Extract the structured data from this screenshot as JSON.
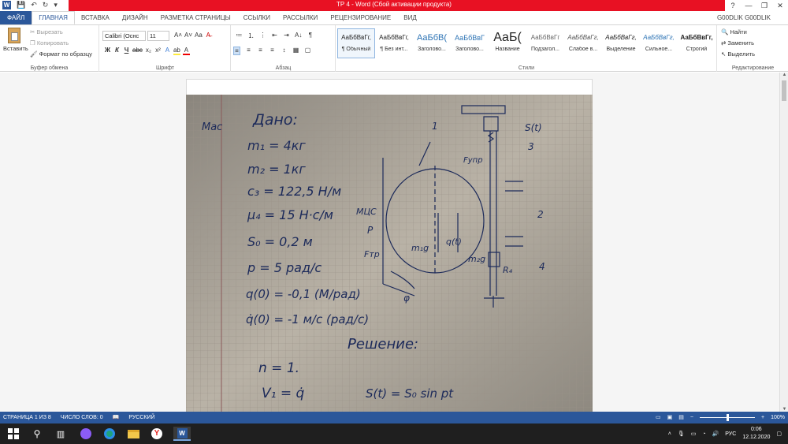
{
  "window": {
    "title": "ТР 4 - Word (Сбой активации продукта)",
    "controls": [
      "?",
      "—",
      "❐",
      "✕"
    ]
  },
  "tabs": [
    {
      "label": "ФАЙЛ"
    },
    {
      "label": "ГЛАВНАЯ"
    },
    {
      "label": "ВСТАВКА"
    },
    {
      "label": "ДИЗАЙН"
    },
    {
      "label": "РАЗМЕТКА СТРАНИЦЫ"
    },
    {
      "label": "ССЫЛКИ"
    },
    {
      "label": "РАССЫЛКИ"
    },
    {
      "label": "РЕЦЕНЗИРОВАНИЕ"
    },
    {
      "label": "ВИД"
    }
  ],
  "user": "G00DLIK G00DLIK",
  "clipboard": {
    "paste": "Вставить",
    "cut": "Вырезать",
    "copy": "Копировать",
    "format_painter": "Формат по образцу",
    "label": "Буфер обмена"
  },
  "font": {
    "name": "Calibri (Оснс",
    "size": "11",
    "label": "Шрифт",
    "row1": [
      "A˄",
      "A˅",
      "Aa",
      "A̶"
    ],
    "row2": [
      "Ж",
      "К",
      "Ч",
      "abc",
      "x₂",
      "x²",
      "A",
      "ab",
      "A"
    ]
  },
  "paragraph": {
    "label": "Абзац",
    "row1": [
      "≔",
      "⒈",
      "⋮",
      "⇤",
      "⇥",
      "A↓",
      "¶"
    ],
    "row2": [
      "≡",
      "≡",
      "≡",
      "≡",
      "↕",
      "▦",
      "▢"
    ]
  },
  "styles": {
    "label": "Стили",
    "items": [
      {
        "sample": "АаБбВвГг,",
        "name": "¶ Обычный"
      },
      {
        "sample": "АаБбВвГг,",
        "name": "¶ Без инт..."
      },
      {
        "sample": "АаБбВ(",
        "name": "Заголово..."
      },
      {
        "sample": "АаБбВвГ",
        "name": "Заголово..."
      },
      {
        "sample": "АаБ(",
        "name": "Название"
      },
      {
        "sample": "АаБбВвГг",
        "name": "Подзагол..."
      },
      {
        "sample": "АаБбВвГг,",
        "name": "Слабое в..."
      },
      {
        "sample": "АаБбВвГг,",
        "name": "Выделение"
      },
      {
        "sample": "АаБбВвГг,",
        "name": "Сильное..."
      },
      {
        "sample": "АаБбВвГг,",
        "name": "Строгий"
      }
    ]
  },
  "editing": {
    "find": "Найти",
    "replace": "Заменить",
    "select": "Выделить",
    "label": "Редактирование"
  },
  "handwriting": {
    "header": "Мас",
    "given": "Дано:",
    "m1": "m₁ = 4кг",
    "m2": "m₂ = 1кг",
    "c3": "c₃ = 122,5 Н/м",
    "m4": "μ₄ = 15 Н·с/м",
    "s0": "S₀ = 0,2 м",
    "p": "p = 5 рад/с",
    "q0": "q(0) = -0,1 (М/рад)",
    "qdot0": "q̇(0) = -1 м/с (рад/с)",
    "solution": "Решение:",
    "n": "n = 1.",
    "v1": "V₁ = q̇",
    "st": "S(t) = S₀ sin pt",
    "diagram": {
      "label_1": "1",
      "label_2": "2",
      "label_3": "3",
      "label_4": "4",
      "s_t": "S(t)",
      "f_upr": "Fупр",
      "mcs": "МЦС",
      "p": "P",
      "f_tr": "Fтр",
      "m1g": "m₁g",
      "q_t": "q(t)",
      "m2g": "m₂g",
      "r4": "R₄",
      "phi": "φ"
    }
  },
  "status": {
    "page": "СТРАНИЦА 1 ИЗ 8",
    "words": "ЧИСЛО СЛОВ: 0",
    "language": "РУССКИЙ",
    "zoom": "100%"
  },
  "taskbar": {
    "lang": "РУС",
    "time": "0:06",
    "date": "12.12.2020"
  }
}
